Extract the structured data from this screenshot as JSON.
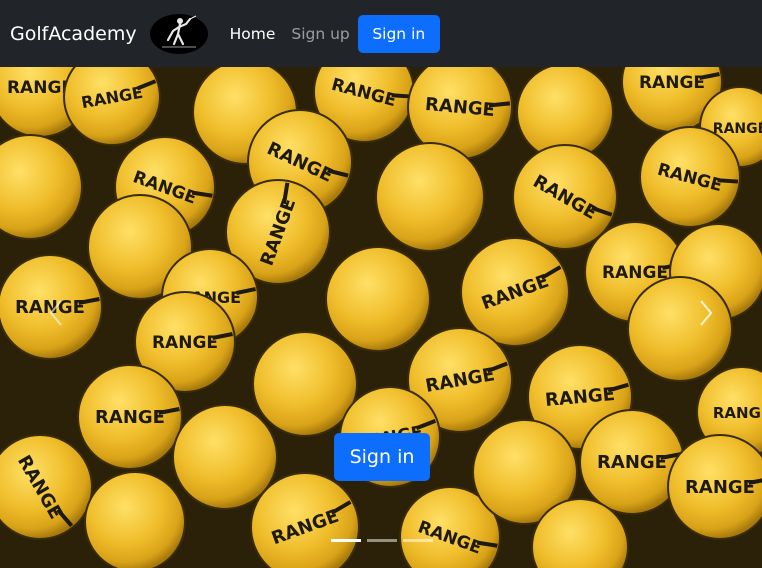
{
  "navbar": {
    "brand": "GolfAcademy",
    "logo_icon": "golfer-silhouette-icon",
    "links": [
      {
        "label": "Home",
        "active": true
      },
      {
        "label": "Sign up",
        "active": false
      }
    ],
    "signin_label": "Sign in",
    "background": "#212529",
    "accent": "#0d6efd"
  },
  "carousel": {
    "image_text": "RANGE",
    "caption_button_label": "Sign in",
    "prev_icon": "chevron-left-icon",
    "next_icon": "chevron-right-icon",
    "indicator_count": 3,
    "active_indicator": 1
  }
}
